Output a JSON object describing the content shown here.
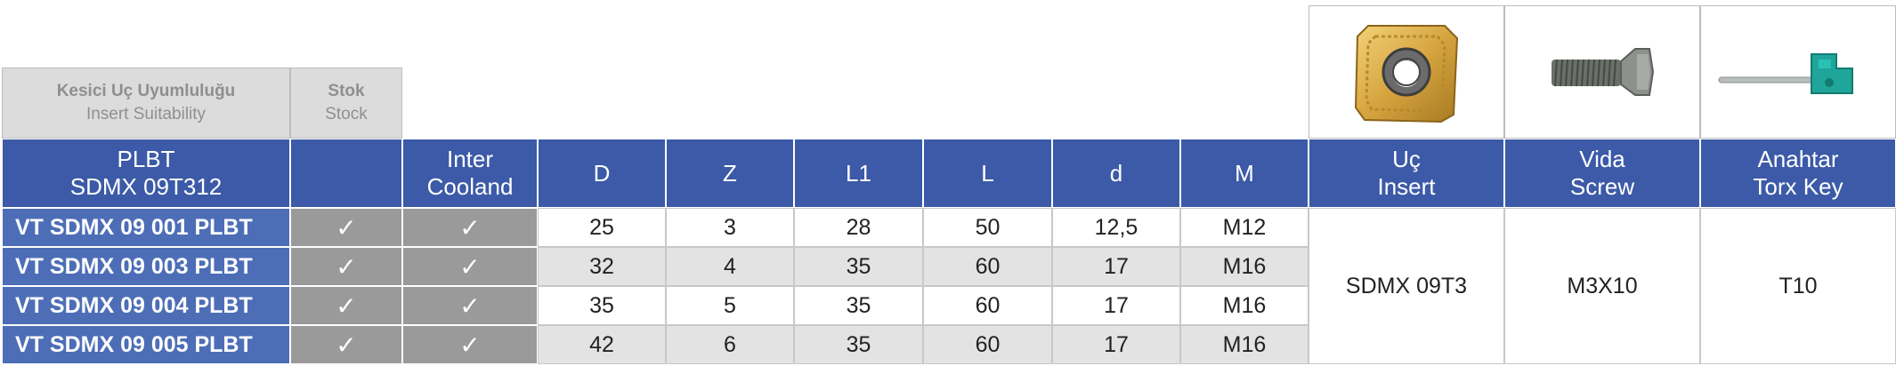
{
  "compat_header": {
    "title_tr": "Kesici Uç Uyumluluğu",
    "title_en": "Insert Suitability",
    "stock_tr": "Stok",
    "stock_en": "Stock"
  },
  "images": {
    "insert": "insert-image",
    "screw": "screw-image",
    "key": "torx-key-image"
  },
  "columns": {
    "insert_line1": "PLBT",
    "insert_line2": "SDMX 09T312",
    "stock": "",
    "coolant_line1": "Inter",
    "coolant_line2": "Cooland",
    "D": "D",
    "Z": "Z",
    "L1": "L1",
    "L": "L",
    "d": "d",
    "M": "M",
    "uc_line1": "Uç",
    "uc_line2": "Insert",
    "vida_line1": "Vida",
    "vida_line2": "Screw",
    "anahtar_line1": "Anahtar",
    "anahtar_line2": "Torx Key"
  },
  "rows": [
    {
      "code": "VT SDMX 09 001 PLBT",
      "insert_ok": "✓",
      "coolant_ok": "✓",
      "D": "25",
      "Z": "3",
      "L1": "28",
      "L": "50",
      "d": "12,5",
      "M": "M12"
    },
    {
      "code": "VT SDMX 09 003 PLBT",
      "insert_ok": "✓",
      "coolant_ok": "✓",
      "D": "32",
      "Z": "4",
      "L1": "35",
      "L": "60",
      "d": "17",
      "M": "M16"
    },
    {
      "code": "VT SDMX 09 004 PLBT",
      "insert_ok": "✓",
      "coolant_ok": "✓",
      "D": "35",
      "Z": "5",
      "L1": "35",
      "L": "60",
      "d": "17",
      "M": "M16"
    },
    {
      "code": "VT SDMX 09 005 PLBT",
      "insert_ok": "✓",
      "coolant_ok": "✓",
      "D": "42",
      "Z": "6",
      "L1": "35",
      "L": "60",
      "d": "17",
      "M": "M16"
    }
  ],
  "accessories": {
    "insert": "SDMX 09T3",
    "screw": "M3X10",
    "key": "T10"
  }
}
